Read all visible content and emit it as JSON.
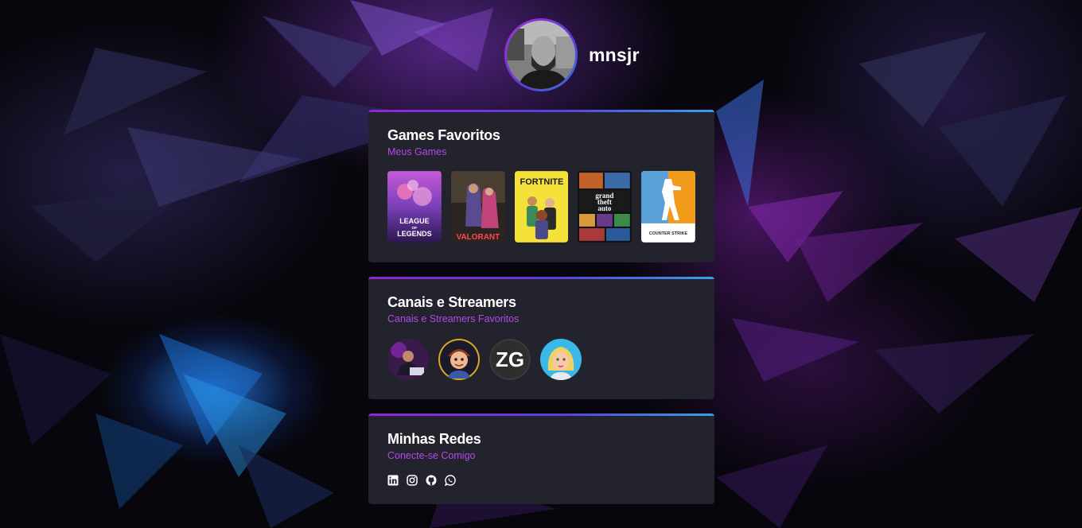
{
  "profile": {
    "username": "mnsjr"
  },
  "cards": {
    "games": {
      "title": "Games Favoritos",
      "subtitle": "Meus Games",
      "items": [
        {
          "name": "League of Legends",
          "logo_text": [
            "LEAGUE",
            "OF",
            "LEGENDS"
          ]
        },
        {
          "name": "Valorant",
          "logo_text": "VALORANT"
        },
        {
          "name": "Fortnite",
          "logo_text": "FORTNITE"
        },
        {
          "name": "Grand Theft Auto V",
          "logo_text": [
            "grand",
            "theft",
            "auto"
          ]
        },
        {
          "name": "Counter-Strike",
          "logo_text": "COUNTER STRIKE"
        }
      ]
    },
    "streamers": {
      "title": "Canais e Streamers",
      "subtitle": "Canais e Streamers Favoritos",
      "items": [
        {
          "icon": "streamer-1-avatar"
        },
        {
          "icon": "streamer-2-avatar"
        },
        {
          "icon": "streamer-3-avatar",
          "logo_text": "ZG"
        },
        {
          "icon": "streamer-4-avatar"
        }
      ]
    },
    "social": {
      "title": "Minhas Redes",
      "subtitle": "Conecte-se Comigo",
      "items": [
        {
          "icon": "linkedin-icon"
        },
        {
          "icon": "instagram-icon"
        },
        {
          "icon": "github-icon"
        },
        {
          "icon": "whatsapp-icon"
        }
      ]
    }
  },
  "colors": {
    "card_bg": "#23232d",
    "accent_purple": "#b548e8",
    "accent_gradient_start": "#8f26d6",
    "accent_gradient_end": "#38a0e8",
    "page_bg": "#07060c"
  }
}
